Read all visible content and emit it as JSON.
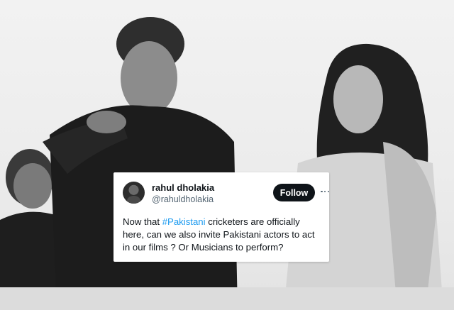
{
  "tweet": {
    "display_name": "rahul dholakia",
    "handle": "@rahuldholakia",
    "follow_label": "Follow",
    "more_icon": "more-horizontal-icon",
    "avatar_icon": "profile-avatar",
    "text_before": "Now that ",
    "hashtag": "#Pakistani",
    "text_after": " cricketers are officially here, can we also invite Pakistani actors to act in our films ? Or Musicians to perform?"
  },
  "colors": {
    "hashtag": "#1d9bf0",
    "follow_button_bg": "#0f1419",
    "card_bg": "#ffffff"
  }
}
